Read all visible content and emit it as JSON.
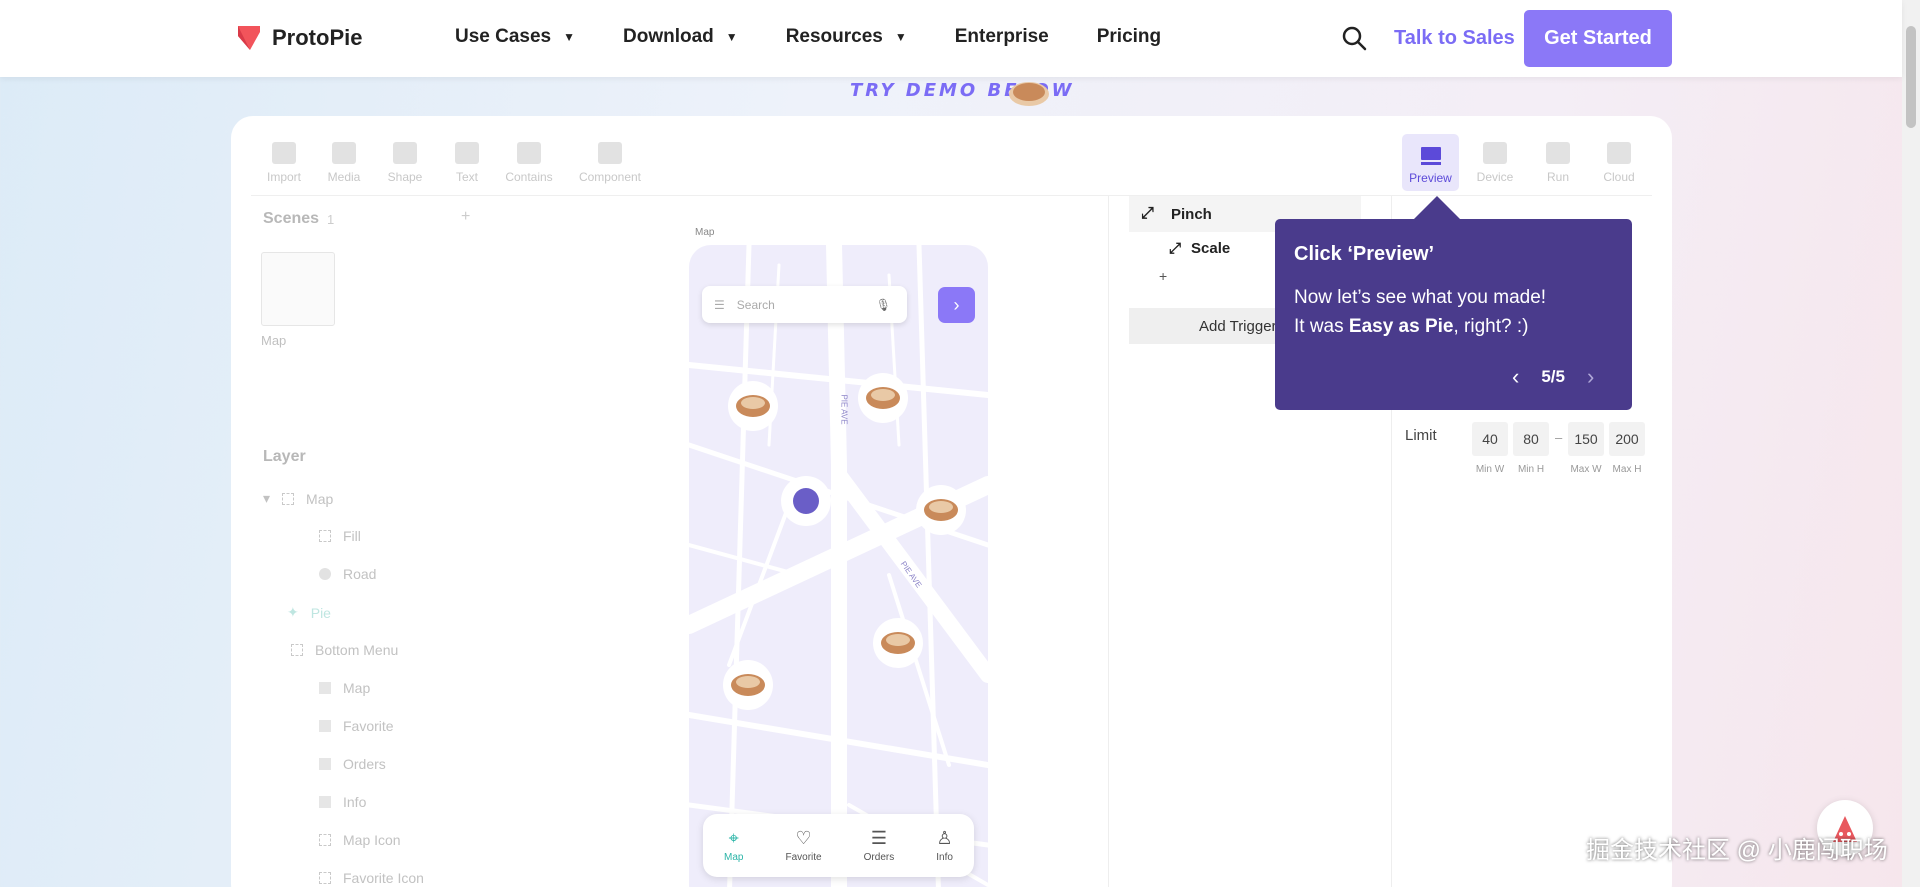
{
  "nav": {
    "brand": "ProtoPie",
    "menu": [
      {
        "label": "Use Cases",
        "caret": "▼"
      },
      {
        "label": "Download",
        "caret": "▼"
      },
      {
        "label": "Resources",
        "caret": "▼"
      },
      {
        "label": "Enterprise",
        "caret": ""
      },
      {
        "label": "Pricing",
        "caret": ""
      }
    ],
    "talk_label": "Talk to Sales",
    "cta_label": "Get Started"
  },
  "banner": {
    "text": "TRY DEMO BELOW"
  },
  "toolbar": {
    "items": [
      "Import",
      "Media",
      "Shape",
      "Text",
      "Contains",
      "Component"
    ],
    "right_items": [
      "Preview",
      "Device",
      "Run",
      "Cloud"
    ]
  },
  "scenes": {
    "title": "Scenes",
    "count": "1",
    "scene_label": "Map"
  },
  "layer": {
    "title": "Layer",
    "rows": [
      "Map",
      "Fill",
      "Road",
      "Pie",
      "Bottom Menu",
      "Map",
      "Favorite",
      "Orders",
      "Info",
      "Map Icon",
      "Favorite Icon"
    ]
  },
  "phone": {
    "label": "Map",
    "search_placeholder": "Search",
    "street1": "PIE AVE",
    "street2": "PIE AVE",
    "bottom_menu": [
      "Map",
      "Favorite",
      "Orders",
      "Info"
    ]
  },
  "interaction": {
    "trigger": "Pinch",
    "response": "Scale",
    "add_trigger": "Add Trigger"
  },
  "props": {
    "limit_label": "Limit",
    "values": [
      "40",
      "80",
      "150",
      "200"
    ],
    "dash": "–",
    "captions": [
      "Min W",
      "Min H",
      "Max W",
      "Max H"
    ]
  },
  "tooltip": {
    "title": "Click ‘Preview’",
    "line1": "Now let’s see what you made!",
    "line2_pre": "It was ",
    "line2_bold": "Easy as Pie",
    "line2_post": ", right? :)",
    "pager": "5/5"
  },
  "watermark": "掘金技术社区 @ 小鹿闯职场",
  "colors": {
    "accent": "#8b78f7",
    "tooltip": "#4a3b8c",
    "active": "#2cb5a8"
  }
}
